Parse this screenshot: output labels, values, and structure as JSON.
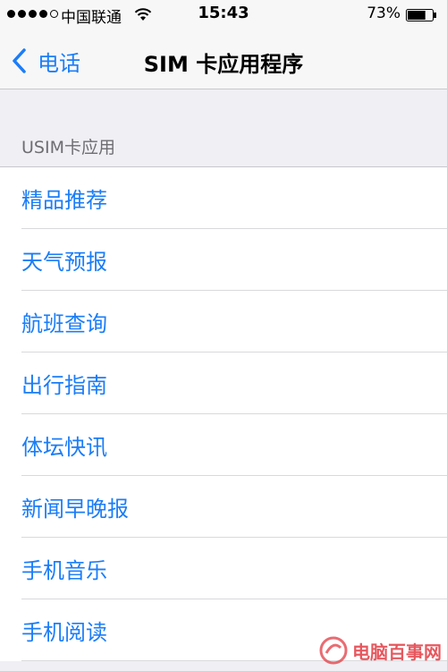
{
  "status_bar": {
    "carrier": "中国联通",
    "time": "15:43",
    "battery_percent": "73%",
    "battery_level": 0.73,
    "signal_bars_filled": 4,
    "signal_bars_total": 5
  },
  "nav_bar": {
    "back_label": "电话",
    "title": "SIM 卡应用程序"
  },
  "section": {
    "header": "USIM卡应用",
    "items": [
      {
        "label": "精品推荐"
      },
      {
        "label": "天气预报"
      },
      {
        "label": "航班查询"
      },
      {
        "label": "出行指南"
      },
      {
        "label": "体坛快讯"
      },
      {
        "label": "新闻早晚报"
      },
      {
        "label": "手机音乐"
      },
      {
        "label": "手机阅读"
      }
    ]
  },
  "watermark": {
    "text": "电脑百事网"
  },
  "colors": {
    "accent": "#1b7df7",
    "background": "#efeff4",
    "watermark": "#e23b43"
  }
}
